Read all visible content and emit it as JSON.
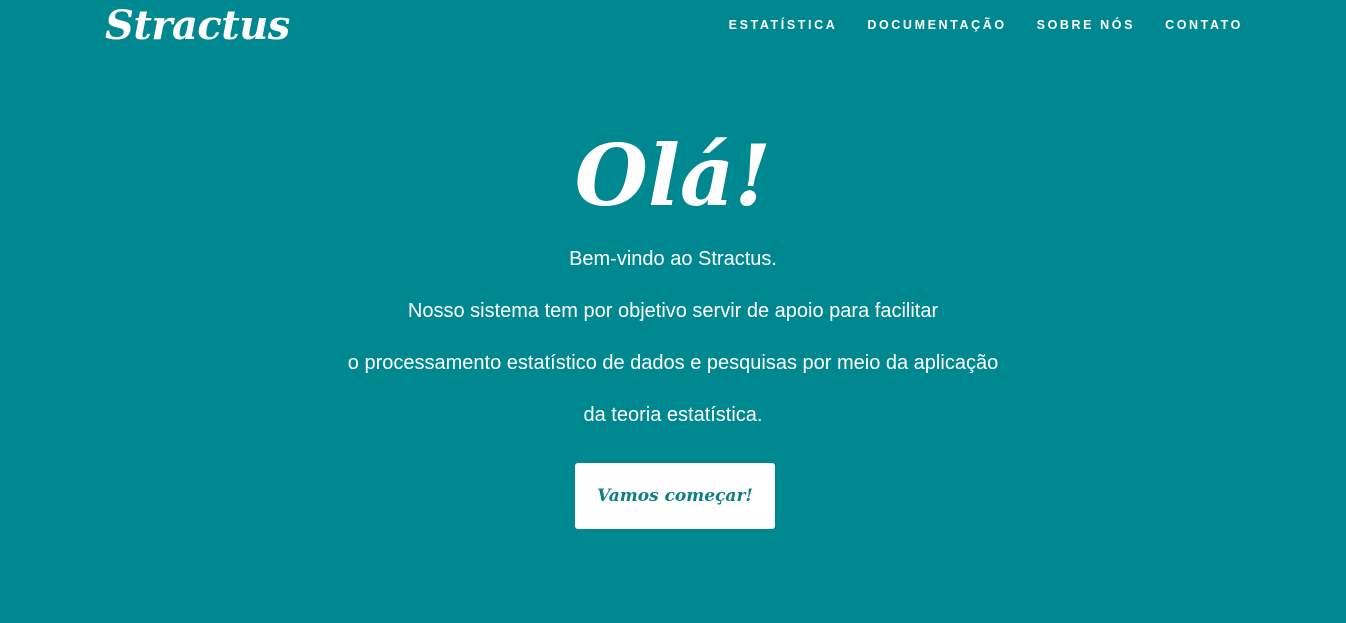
{
  "brand": {
    "logo_text": "Stractus"
  },
  "nav": {
    "items": [
      {
        "label": "ESTATÍSTICA"
      },
      {
        "label": "DOCUMENTAÇÃO"
      },
      {
        "label": "SOBRE NÓS"
      },
      {
        "label": "CONTATO"
      }
    ]
  },
  "hero": {
    "title": "Olá!",
    "lines": [
      "Bem-vindo ao Stractus.",
      "Nosso sistema tem por objetivo servir de apoio para facilitar",
      "o processamento estatístico de dados e pesquisas por meio da aplicação",
      "da teoria estatística."
    ],
    "cta_label": "Vamos começar!"
  },
  "colors": {
    "background": "#008891",
    "text": "#ffffff",
    "button_background": "#ffffff",
    "button_text": "#0c7f86"
  }
}
